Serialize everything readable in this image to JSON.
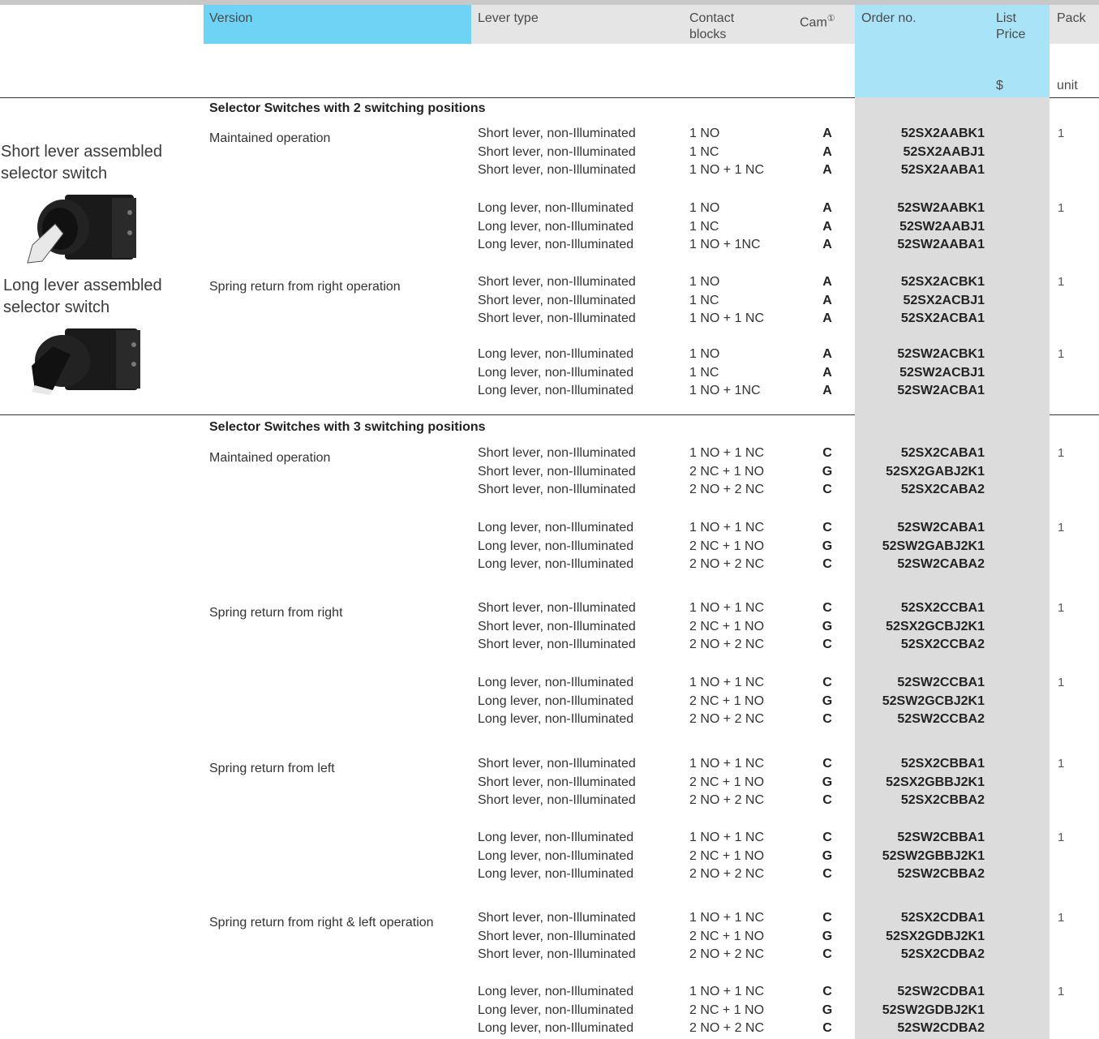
{
  "header": {
    "version": "Version",
    "lever_type": "Lever type",
    "contact_blocks": "Contact blocks",
    "cam": "Cam",
    "cam_note": "①",
    "order_no": "Order no.",
    "list_price": "List Price",
    "pack": "Pack",
    "currency": "$",
    "unit": "unit"
  },
  "colors": {
    "header_blue": "#6fd3f5",
    "order_column": "#dcdcdc",
    "header_gray": "#e5e5e5"
  },
  "left_panel": {
    "short_label": "Short lever assembled selector switch",
    "long_label": "Long lever assembled selector switch"
  },
  "section1": {
    "title": "Selector Switches with 2 switching positions",
    "groups": [
      {
        "version": "Maintained operation",
        "pack": "1",
        "rows": [
          {
            "lever": "Short lever, non-Illuminated",
            "contact": "1 NO",
            "cam": "A",
            "order": "52SX2AABK1"
          },
          {
            "lever": "Short lever, non-Illuminated",
            "contact": "1 NC",
            "cam": "A",
            "order": "52SX2AABJ1"
          },
          {
            "lever": "Short lever, non-Illuminated",
            "contact": "1 NO + 1 NC",
            "cam": "A",
            "order": "52SX2AABA1"
          }
        ]
      },
      {
        "version": "",
        "pack": "1",
        "rows": [
          {
            "lever": "Long  lever, non-Illuminated",
            "contact": "1 NO",
            "cam": "A",
            "order": "52SW2AABK1"
          },
          {
            "lever": "Long  lever, non-Illuminated",
            "contact": "1 NC",
            "cam": "A",
            "order": "52SW2AABJ1"
          },
          {
            "lever": "Long  lever, non-Illuminated",
            "contact": "1 NO + 1NC",
            "cam": "A",
            "order": "52SW2AABA1"
          }
        ]
      },
      {
        "version": "Spring return from right operation",
        "pack": "1",
        "rows": [
          {
            "lever": "Short lever, non-Illuminated",
            "contact": "1 NO",
            "cam": "A",
            "order": "52SX2ACBK1"
          },
          {
            "lever": "Short lever, non-Illuminated",
            "contact": "1 NC",
            "cam": "A",
            "order": "52SX2ACBJ1"
          },
          {
            "lever": "Short lever, non-Illuminated",
            "contact": "1 NO + 1 NC",
            "cam": "A",
            "order": "52SX2ACBA1"
          }
        ]
      },
      {
        "version": "",
        "pack": "1",
        "rows": [
          {
            "lever": "Long  lever, non-Illuminated",
            "contact": "1 NO",
            "cam": "A",
            "order": "52SW2ACBK1"
          },
          {
            "lever": "Long  lever, non-Illuminated",
            "contact": "1 NC",
            "cam": "A",
            "order": "52SW2ACBJ1"
          },
          {
            "lever": "Long  lever, non-Illuminated",
            "contact": "1 NO + 1NC",
            "cam": "A",
            "order": "52SW2ACBA1"
          }
        ]
      }
    ]
  },
  "section2": {
    "title": "Selector Switches with 3 switching positions",
    "groups": [
      {
        "version": "Maintained operation",
        "pack": "1",
        "rows": [
          {
            "lever": "Short lever, non-Illuminated",
            "contact": "1 NO + 1 NC",
            "cam": "C",
            "order": "52SX2CABA1"
          },
          {
            "lever": "Short lever, non-Illuminated",
            "contact": "2 NC + 1 NO",
            "cam": "G",
            "order": "52SX2GABJ2K1"
          },
          {
            "lever": "Short lever, non-Illuminated",
            "contact": "2 NO + 2 NC",
            "cam": "C",
            "order": "52SX2CABA2"
          }
        ]
      },
      {
        "version": "",
        "pack": "1",
        "rows": [
          {
            "lever": "Long  lever, non-Illuminated",
            "contact": "1 NO + 1 NC",
            "cam": "C",
            "order": "52SW2CABA1"
          },
          {
            "lever": "Long  lever, non-Illuminated",
            "contact": "2 NC + 1 NO",
            "cam": "G",
            "order": "52SW2GABJ2K1"
          },
          {
            "lever": "Long  lever, non-Illuminated",
            "contact": "2 NO + 2 NC",
            "cam": "C",
            "order": "52SW2CABA2"
          }
        ]
      },
      {
        "version": "Spring return from right",
        "pack": "1",
        "rows": [
          {
            "lever": "Short lever, non-Illuminated",
            "contact": "1 NO + 1 NC",
            "cam": "C",
            "order": "52SX2CCBA1"
          },
          {
            "lever": "Short lever, non-Illuminated",
            "contact": "2 NC + 1 NO",
            "cam": "G",
            "order": "52SX2GCBJ2K1"
          },
          {
            "lever": "Short lever, non-Illuminated",
            "contact": "2 NO + 2 NC",
            "cam": "C",
            "order": "52SX2CCBA2"
          }
        ]
      },
      {
        "version": "",
        "pack": "1",
        "rows": [
          {
            "lever": "Long  lever, non-Illuminated",
            "contact": "1 NO + 1 NC",
            "cam": "C",
            "order": "52SW2CCBA1"
          },
          {
            "lever": "Long  lever, non-Illuminated",
            "contact": "2 NC + 1 NO",
            "cam": "G",
            "order": "52SW2GCBJ2K1"
          },
          {
            "lever": "Long  lever, non-Illuminated",
            "contact": "2 NO + 2 NC",
            "cam": "C",
            "order": "52SW2CCBA2"
          }
        ]
      },
      {
        "version": "Spring return from left",
        "pack": "1",
        "rows": [
          {
            "lever": "Short lever, non-Illuminated",
            "contact": "1 NO + 1 NC",
            "cam": "C",
            "order": "52SX2CBBA1"
          },
          {
            "lever": "Short lever, non-Illuminated",
            "contact": "2 NC + 1 NO",
            "cam": "G",
            "order": "52SX2GBBJ2K1"
          },
          {
            "lever": "Short lever, non-Illuminated",
            "contact": "2 NO + 2 NC",
            "cam": "C",
            "order": "52SX2CBBA2"
          }
        ]
      },
      {
        "version": "",
        "pack": "1",
        "rows": [
          {
            "lever": "Long  lever, non-Illuminated",
            "contact": "1 NO + 1 NC",
            "cam": "C",
            "order": "52SW2CBBA1"
          },
          {
            "lever": "Long  lever, non-Illuminated",
            "contact": "2 NC + 1 NO",
            "cam": "G",
            "order": "52SW2GBBJ2K1"
          },
          {
            "lever": "Long  lever, non-Illuminated",
            "contact": "2 NO + 2 NC",
            "cam": "C",
            "order": "52SW2CBBA2"
          }
        ]
      },
      {
        "version": "Spring return from right & left operation",
        "pack": "1",
        "rows": [
          {
            "lever": "Short lever, non-Illuminated",
            "contact": "1 NO + 1 NC",
            "cam": "C",
            "order": "52SX2CDBA1"
          },
          {
            "lever": "Short lever, non-Illuminated",
            "contact": "2 NC + 1 NO",
            "cam": "G",
            "order": "52SX2GDBJ2K1"
          },
          {
            "lever": "Short lever, non-Illuminated",
            "contact": "2 NO + 2 NC",
            "cam": "C",
            "order": "52SX2CDBA2"
          }
        ]
      },
      {
        "version": "",
        "pack": "1",
        "rows": [
          {
            "lever": "Long  lever, non-Illuminated",
            "contact": "1 NO + 1 NC",
            "cam": "C",
            "order": "52SW2CDBA1"
          },
          {
            "lever": "Long  lever, non-Illuminated",
            "contact": "2 NC + 1 NO",
            "cam": "G",
            "order": "52SW2GDBJ2K1"
          },
          {
            "lever": "Long  lever, non-Illuminated",
            "contact": "2 NO + 2 NC",
            "cam": "C",
            "order": "52SW2CDBA2"
          }
        ]
      }
    ]
  }
}
